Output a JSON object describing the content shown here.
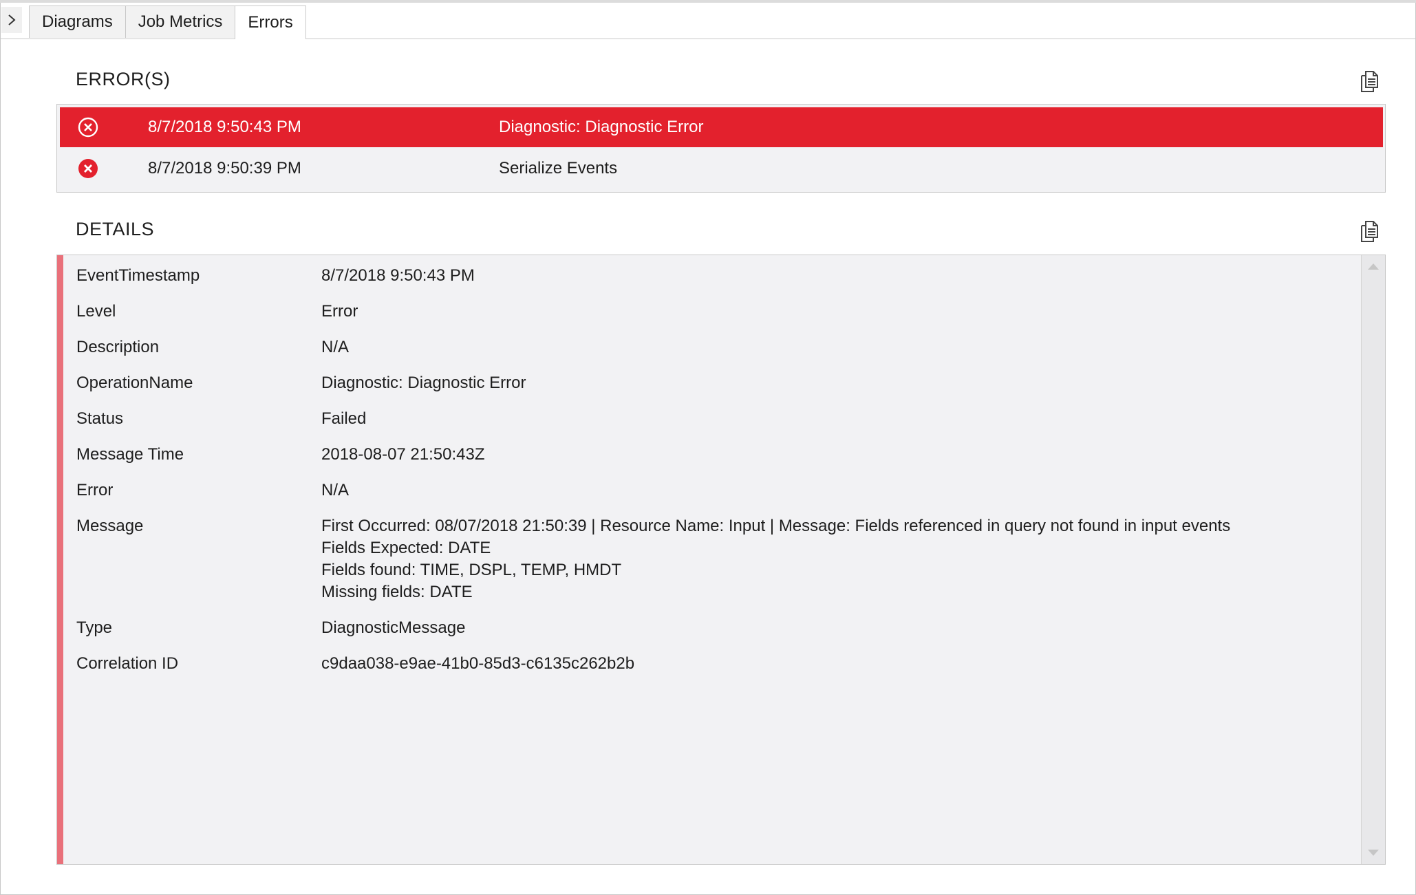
{
  "tabs": [
    {
      "label": "Diagrams"
    },
    {
      "label": "Job Metrics"
    },
    {
      "label": "Errors"
    }
  ],
  "active_tab": "Errors",
  "errors_section": {
    "title": "ERROR(S)",
    "copy_icon": "copy-icon",
    "rows": [
      {
        "time": "8/7/2018 9:50:43 PM",
        "message": "Diagnostic: Diagnostic Error",
        "selected": true,
        "icon": "error-circle-icon"
      },
      {
        "time": "8/7/2018 9:50:39 PM",
        "message": "Serialize Events",
        "selected": false,
        "icon": "error-circle-icon"
      }
    ]
  },
  "details_section": {
    "title": "DETAILS",
    "copy_icon": "copy-icon",
    "rows": [
      {
        "key": "EventTimestamp",
        "value": "8/7/2018 9:50:43 PM"
      },
      {
        "key": "Level",
        "value": "Error"
      },
      {
        "key": "Description",
        "value": "N/A"
      },
      {
        "key": "OperationName",
        "value": "Diagnostic: Diagnostic Error"
      },
      {
        "key": "Status",
        "value": "Failed"
      },
      {
        "key": "Message Time",
        "value": "2018-08-07 21:50:43Z"
      },
      {
        "key": "Error",
        "value": "N/A"
      },
      {
        "key": "Message",
        "value": "First Occurred: 08/07/2018 21:50:39 | Resource Name: Input | Message: Fields referenced in query not found in input events\nFields Expected: DATE\nFields found: TIME, DSPL, TEMP, HMDT\nMissing fields: DATE"
      },
      {
        "key": "Type",
        "value": "DiagnosticMessage"
      },
      {
        "key": "Correlation ID",
        "value": "c9daa038-e9ae-41b0-85d3-c6135c262b2b"
      }
    ]
  },
  "colors": {
    "selected_row": "#e3212d",
    "error_icon": "#e3212d",
    "details_accent": "#e9707a",
    "panel_bg": "#f2f2f4"
  }
}
